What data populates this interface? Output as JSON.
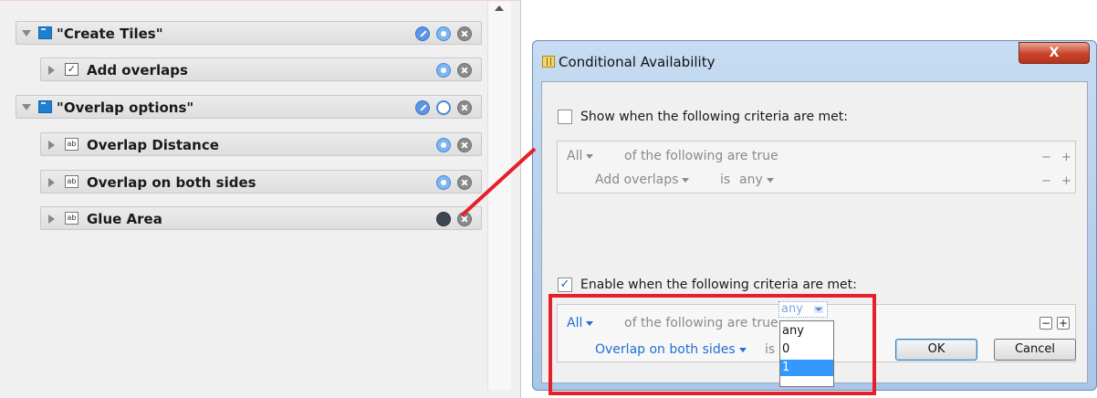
{
  "left_panel": {
    "rows": [
      {
        "label": "\"Create Tiles\"",
        "icon": "folder-icon",
        "expanded": true
      },
      {
        "label": "Add overlaps",
        "icon": "checkbox-field-icon",
        "expanded": false
      },
      {
        "label": "\"Overlap options\"",
        "icon": "folder-icon",
        "expanded": true
      },
      {
        "label": "Overlap Distance",
        "icon": "text-field-icon",
        "expanded": false
      },
      {
        "label": "Overlap on both sides",
        "icon": "text-field-icon",
        "expanded": false
      },
      {
        "label": "Glue Area",
        "icon": "text-field-icon",
        "expanded": false
      }
    ],
    "check_glyph": "✓",
    "ab_glyph": "ab"
  },
  "dialog": {
    "title": "Conditional Availability",
    "close_label": "X",
    "show_section": {
      "label": "Show when the following criteria are met:",
      "checked": false,
      "quantifier": "All",
      "quantifier_suffix": "of the following are true",
      "field": "Add overlaps",
      "operator": "is",
      "value": "any"
    },
    "enable_section": {
      "label": "Enable when the following criteria are met:",
      "checked": true,
      "checkmark": "✓",
      "quantifier": "All",
      "quantifier_suffix": "of the following are true",
      "field": "Overlap on both sides",
      "operator": "is",
      "value": "any"
    },
    "dropdown_options": [
      "any",
      "0",
      "1"
    ],
    "dropdown_selected": "1",
    "minus": "−",
    "plus": "+",
    "ok_label": "OK",
    "cancel_label": "Cancel"
  },
  "colors": {
    "annotation_red": "#e5202a",
    "link_blue": "#1f6fd6",
    "selection_blue": "#3399ff"
  }
}
